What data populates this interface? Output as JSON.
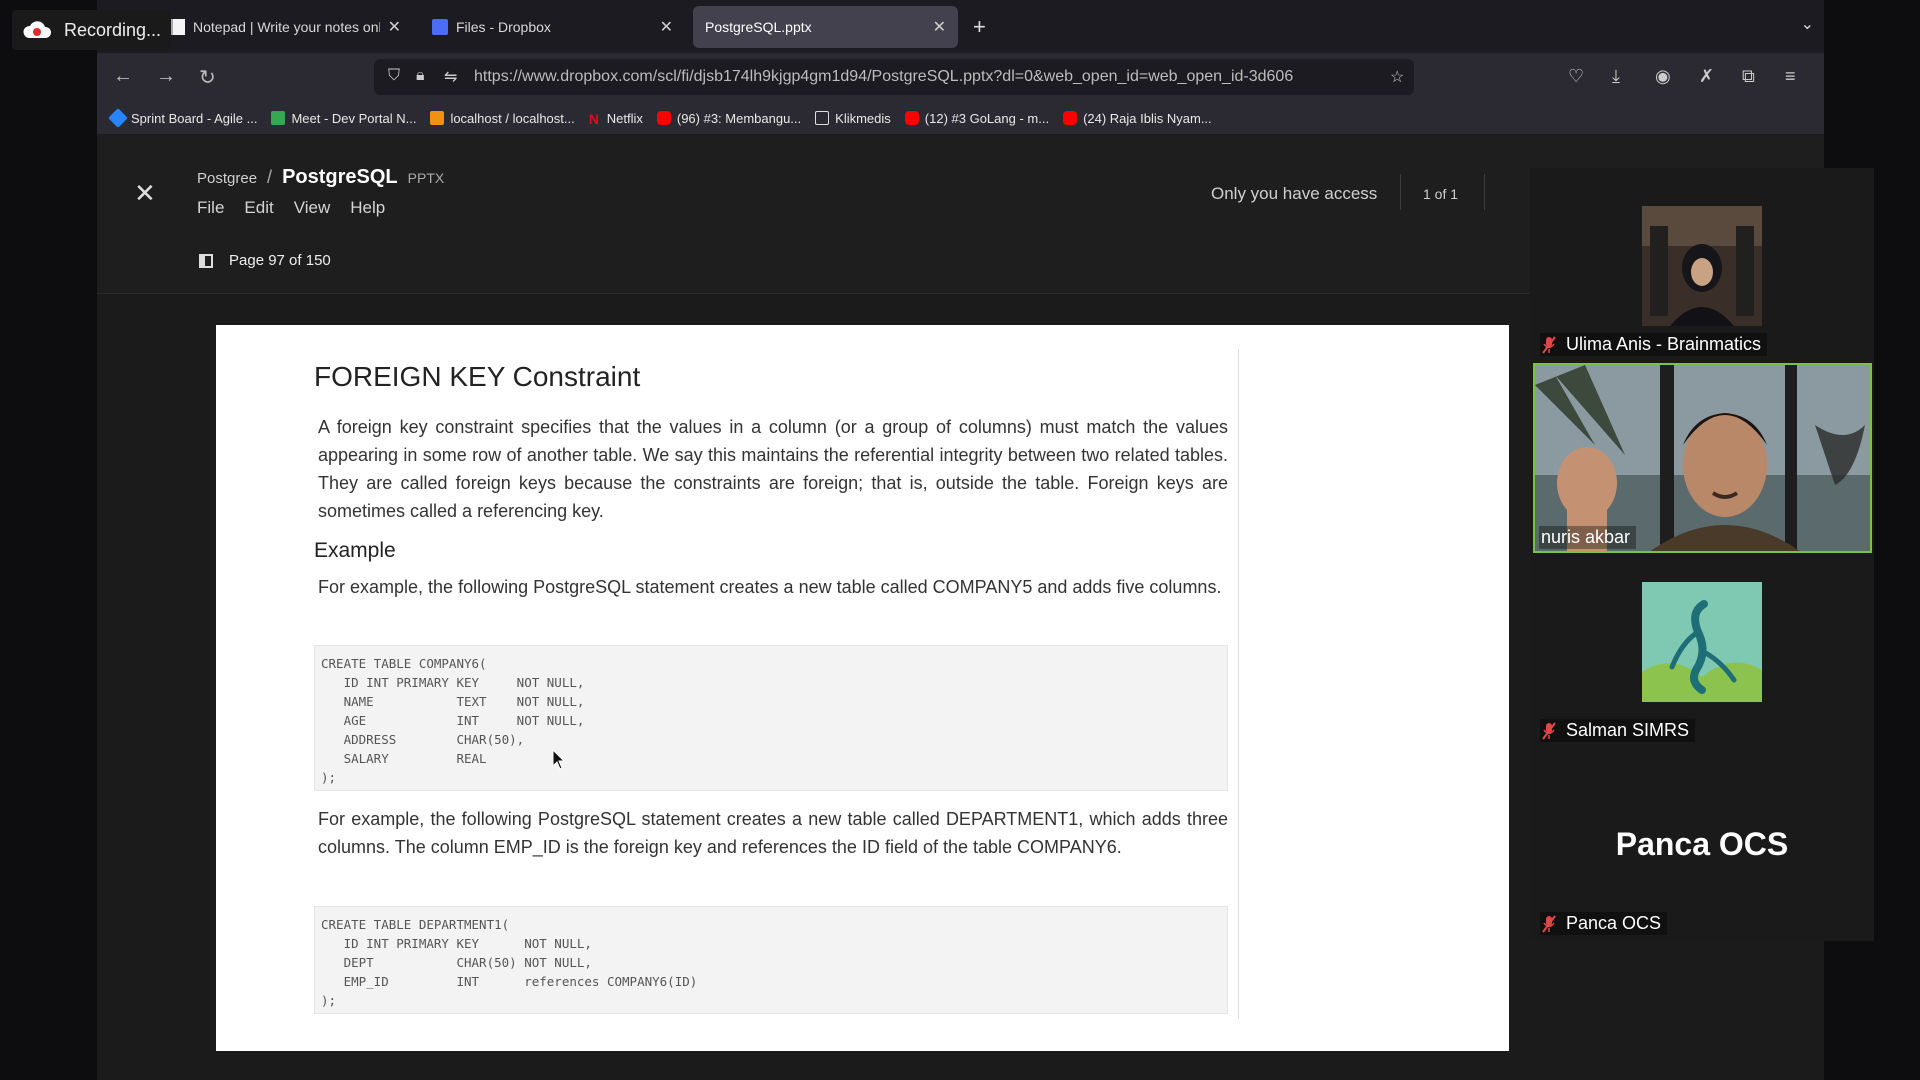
{
  "recording_label": "Recording...",
  "tabs": [
    {
      "title": "Notepad | Write your notes online"
    },
    {
      "title": "Files - Dropbox"
    },
    {
      "title": "PostgreSQL.pptx"
    }
  ],
  "url": "https://www.dropbox.com/scl/fi/djsb174lh9kjgp4gm1d94/PostgreSQL.pptx?dl=0&web_open_id=web_open_id-3d606",
  "bookmarks": [
    {
      "label": "Sprint Board - Agile ...",
      "color": "#2684ff"
    },
    {
      "label": "Meet - Dev Portal N...",
      "color": "#34a853"
    },
    {
      "label": "localhost / localhost...",
      "color": "#f29111"
    },
    {
      "label": "Netflix",
      "color": "#e50914"
    },
    {
      "label": "(96) #3: Membangu...",
      "color": "#ff0000"
    },
    {
      "label": "Klikmedis",
      "color": "#888888"
    },
    {
      "label": "(12) #3 GoLang - m...",
      "color": "#ff0000"
    },
    {
      "label": "(24) Raja Iblis Nyam...",
      "color": "#ff0000"
    }
  ],
  "viewer": {
    "folder": "Postgree",
    "filename": "PostgreSQL",
    "ext": "PPTX",
    "menu": [
      "File",
      "Edit",
      "View",
      "Help"
    ],
    "access": "Only you have access",
    "page_count": "1 of 1",
    "page_info": "Page 97 of 150"
  },
  "slide": {
    "title": "FOREIGN KEY Constraint",
    "para1": "A foreign key constraint specifies that the values in a column (or a group of columns) must match the values appearing in some row of another table. We say this maintains the referential integrity between two related tables. They are called foreign keys because the constraints are foreign; that is, outside the table. Foreign keys are sometimes called a referencing key.",
    "example_heading": "Example",
    "para2": "For example, the following PostgreSQL statement creates a new table called COMPANY5 and adds five columns.",
    "code1": "CREATE TABLE COMPANY6(\n   ID INT PRIMARY KEY     NOT NULL,\n   NAME           TEXT    NOT NULL,\n   AGE            INT     NOT NULL,\n   ADDRESS        CHAR(50),\n   SALARY         REAL\n);",
    "para3": "For example, the following PostgreSQL statement creates a new table called DEPARTMENT1, which adds three columns. The column EMP_ID is the foreign key and references the ID field of the table COMPANY6.",
    "code2": "CREATE TABLE DEPARTMENT1(\n   ID INT PRIMARY KEY      NOT NULL,\n   DEPT           CHAR(50) NOT NULL,\n   EMP_ID         INT      references COMPANY6(ID)\n);"
  },
  "participants": [
    {
      "name": "Ulima Anis - Brainmatics"
    },
    {
      "name": "nuris akbar"
    },
    {
      "name": "Salman SIMRS"
    },
    {
      "name": "Panca OCS",
      "display": "Panca OCS"
    }
  ],
  "colors": {
    "active_speaker": "#7cc242",
    "mic_off": "#e04848"
  }
}
